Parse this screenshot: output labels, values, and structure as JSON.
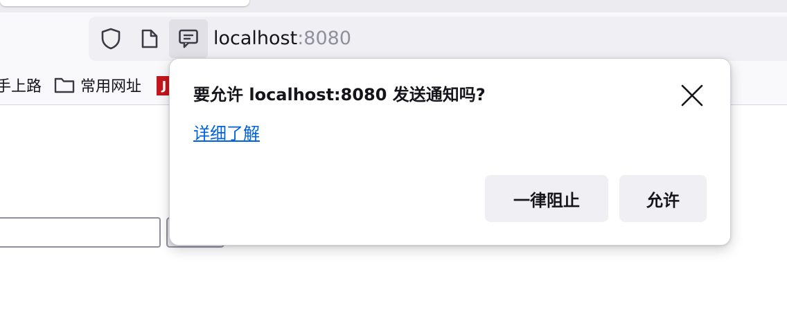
{
  "browser": {
    "url": {
      "host": "localhost",
      "port": ":8080"
    },
    "icons": [
      "shield-icon",
      "page-icon",
      "notification-permission-icon"
    ]
  },
  "bookmarks": {
    "items": [
      {
        "label": "手上路",
        "icon": "none"
      },
      {
        "label": "常用网址",
        "icon": "folder-icon"
      },
      {
        "label": "J",
        "icon": "favicon"
      }
    ]
  },
  "popup": {
    "title": "要允许 localhost:8080 发送通知吗?",
    "learn_more": "详细了解",
    "block_label": "一律阻止",
    "allow_label": "允许"
  },
  "colors": {
    "link": "#0061e0",
    "button_bg": "#f0f0f4",
    "favicon_red": "#c4161c"
  }
}
